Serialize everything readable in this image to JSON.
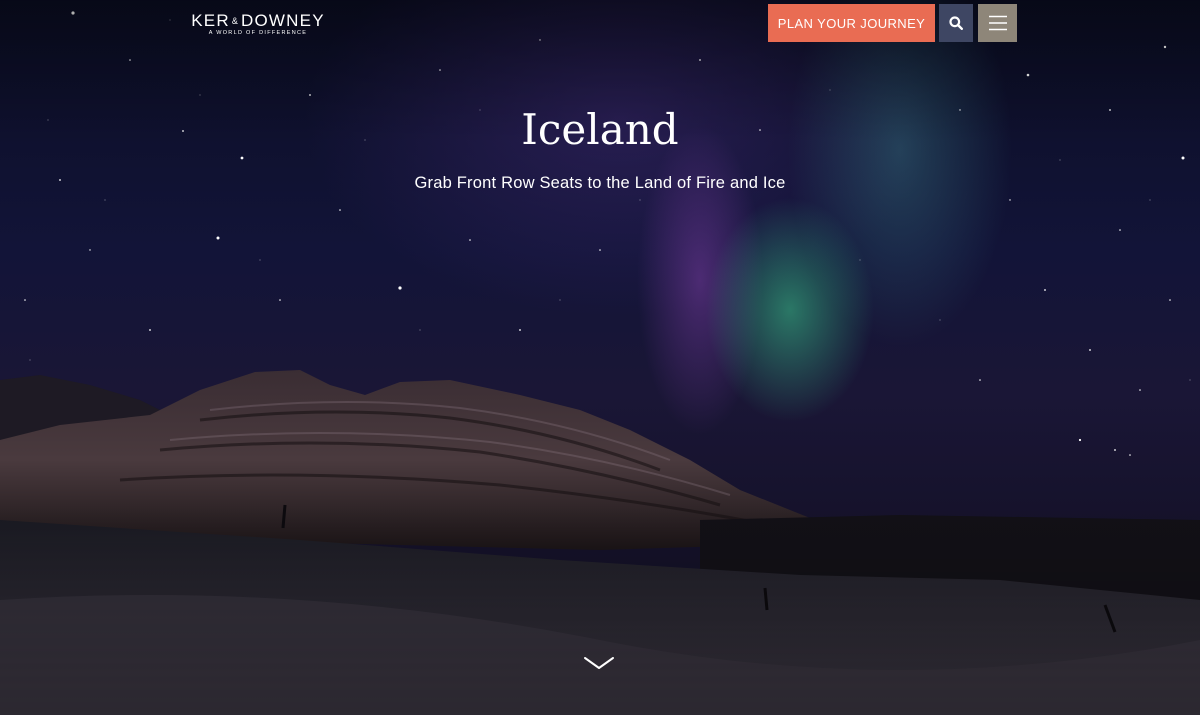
{
  "header": {
    "logo": {
      "name_left": "KER",
      "ampersand": "&",
      "name_right": "DOWNEY",
      "tagline": "A WORLD OF DIFFERENCE"
    },
    "plan_button_label": "PLAN YOUR JOURNEY",
    "search_icon": "search-icon",
    "menu_icon": "hamburger-menu-icon"
  },
  "hero": {
    "title": "Iceland",
    "subtitle": "Grab Front Row Seats to the Land of Fire and Ice",
    "scroll_icon": "chevron-down-icon"
  },
  "colors": {
    "plan_button": "#e96c53",
    "search_button": "#3e4663",
    "menu_button": "#8e8679",
    "text": "#ffffff"
  }
}
